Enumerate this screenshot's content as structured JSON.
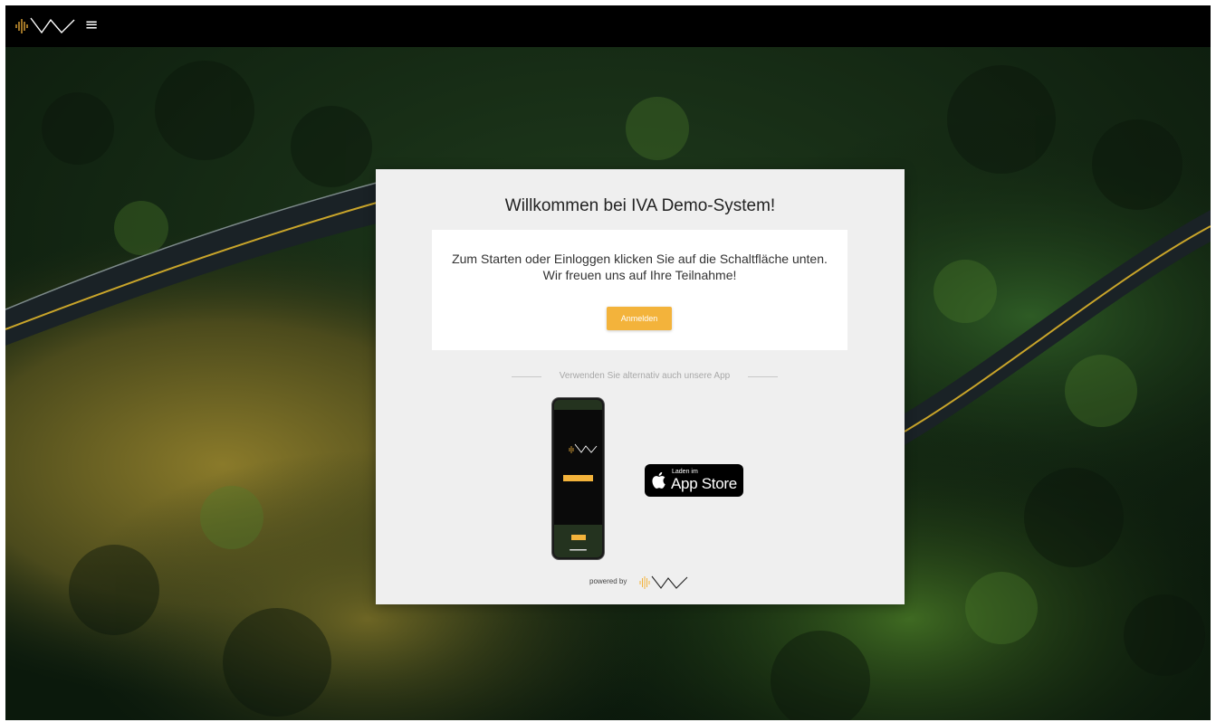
{
  "header": {
    "logo_name": "iva-logo",
    "menu_icon": "hamburger-menu-icon"
  },
  "card": {
    "title": "Willkommen bei IVA Demo-System!",
    "info_line1": "Zum Starten oder Einloggen klicken Sie auf die Schaltfläche unten.",
    "info_line2": "Wir freuen uns auf Ihre Teilnahme!",
    "login_button": "Anmelden",
    "divider_text": "Verwenden Sie alternativ auch unsere App",
    "appstore_small": "Laden im",
    "appstore_big": "App Store",
    "powered_by": "powered by"
  },
  "colors": {
    "accent": "#f3b33b",
    "header_bg": "#000000",
    "card_bg": "#efefef"
  }
}
